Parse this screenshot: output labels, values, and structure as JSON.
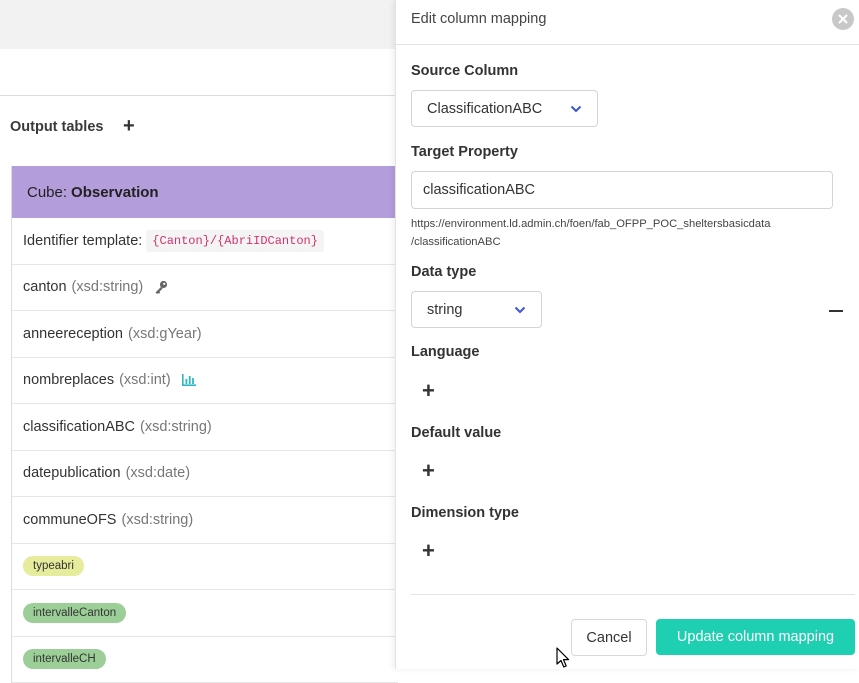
{
  "left": {
    "output_tables_label": "Output tables",
    "add_table_icon": "plus-icon",
    "cube": {
      "prefix": "Cube:",
      "name": "Observation",
      "color": "#b39ddb"
    },
    "identifier": {
      "label": "Identifier template:",
      "value": "{Canton}/{AbriIDCanton}"
    },
    "rows": [
      {
        "name": "canton",
        "type": "(xsd:string)",
        "icon": "key-icon"
      },
      {
        "name": "anneereception",
        "type": "(xsd:gYear)"
      },
      {
        "name": "nombreplaces",
        "type": "(xsd:int)",
        "icon": "measure-icon"
      },
      {
        "name": "classificationABC",
        "type": "(xsd:string)"
      },
      {
        "name": "datepublication",
        "type": "(xsd:date)"
      },
      {
        "name": "communeOFS",
        "type": "(xsd:string)"
      }
    ],
    "tags": [
      {
        "label": "typeabri",
        "color": "#e6ec9b"
      },
      {
        "label": "intervalleCanton",
        "color": "#9ccf98"
      },
      {
        "label": "intervalleCH",
        "color": "#9ccf98"
      }
    ]
  },
  "drawer": {
    "title": "Edit column mapping",
    "source_column": {
      "label": "Source Column",
      "value": "ClassificationABC"
    },
    "target_property": {
      "label": "Target Property",
      "value": "classificationABC",
      "iri_line1": "https://environment.ld.admin.ch/foen/fab_OFPP_POC_sheltersbasicdata",
      "iri_line2": "/classificationABC"
    },
    "data_type": {
      "label": "Data type",
      "value": "string"
    },
    "language": {
      "label": "Language"
    },
    "default_value": {
      "label": "Default value"
    },
    "dimension_type": {
      "label": "Dimension type"
    },
    "cancel_label": "Cancel",
    "update_label": "Update column mapping",
    "accent_color": "#1fcfb1"
  }
}
